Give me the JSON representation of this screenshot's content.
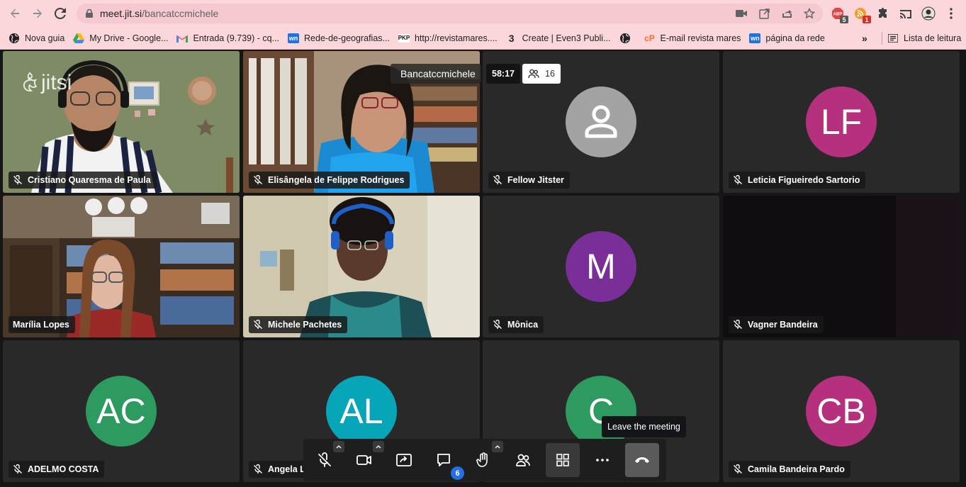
{
  "browser": {
    "url_host": "meet.jit.si",
    "url_path": "/bancatccmichele",
    "extensions": [
      {
        "name": "abp-icon",
        "badge": "5",
        "badge_color": "#555555"
      },
      {
        "name": "feed-icon",
        "badge": "1",
        "badge_color": "#d93025"
      }
    ]
  },
  "bookmarks": [
    {
      "label": "Nova guia",
      "icon": "globe-icon"
    },
    {
      "label": "My Drive - Google...",
      "icon": "drive-icon"
    },
    {
      "label": "Entrada (9.739) - cq...",
      "icon": "gmail-icon"
    },
    {
      "label": "Rede-de-geografias...",
      "icon": "wn-icon"
    },
    {
      "label": "http://revistamares....",
      "icon": "pkp-icon"
    },
    {
      "label": "Create | Even3 Publi...",
      "icon": "even3-icon"
    },
    {
      "label": "",
      "icon": "globe-icon"
    },
    {
      "label": "E-mail revista mares",
      "icon": "cpanel-icon"
    },
    {
      "label": "página da rede",
      "icon": "wn-icon"
    }
  ],
  "reading_list": "Lista de leitura",
  "meeting": {
    "brand": "jitsi",
    "room_name": "Bancatccmichele",
    "timer": "58:17",
    "participant_count": "16",
    "tiles": [
      {
        "name": "Cristiano Quaresma de Paula",
        "type": "video"
      },
      {
        "name": "Elisângela de Felippe Rodrigues",
        "type": "video"
      },
      {
        "name": "Fellow Jitster",
        "type": "avatar-generic"
      },
      {
        "name": "Leticia Figueiredo Sartorio",
        "type": "avatar",
        "initials": "LF",
        "color": "#b5317d"
      },
      {
        "name": "Marília Lopes",
        "type": "video"
      },
      {
        "name": "Michele Pachetes",
        "type": "video"
      },
      {
        "name": "Mônica",
        "type": "avatar",
        "initials": "M",
        "color": "#7a2f98"
      },
      {
        "name": "Vagner Bandeira",
        "type": "dark"
      },
      {
        "name": "ADELMO COSTA",
        "type": "avatar",
        "initials": "AC",
        "color": "#2d9a5f"
      },
      {
        "name": "Angela L",
        "type": "avatar",
        "initials": "AL",
        "color": "#06a5b7"
      },
      {
        "name": "",
        "type": "avatar",
        "initials": "C",
        "color": "#2d9a5f"
      },
      {
        "name": "Camila Bandeira Pardo",
        "type": "avatar",
        "initials": "CB",
        "color": "#b5317d"
      }
    ]
  },
  "toolbar": {
    "chat_badge": "6",
    "tooltip": "Leave the meeting"
  }
}
